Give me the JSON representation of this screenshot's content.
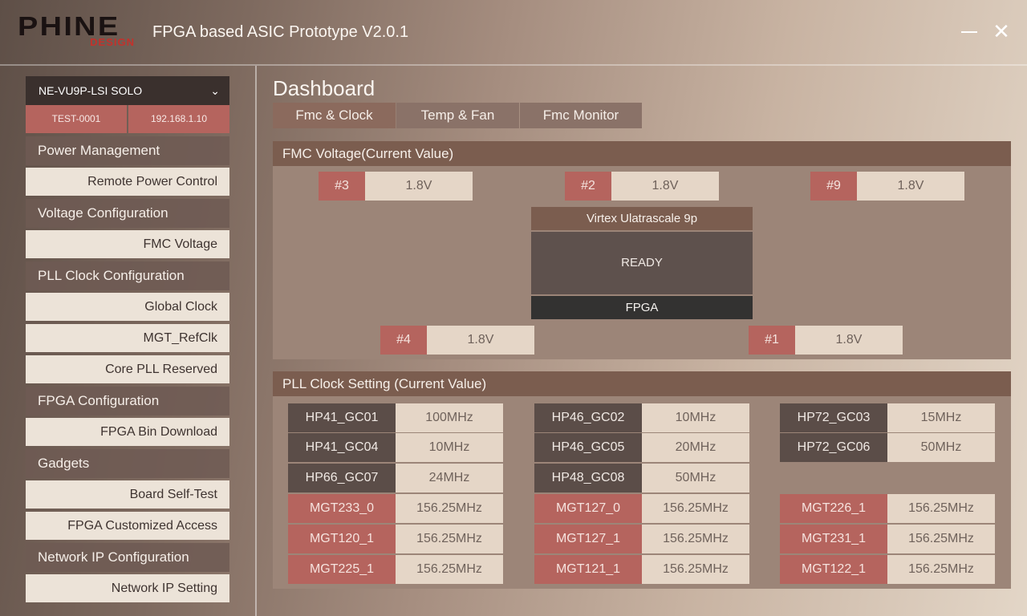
{
  "app": {
    "logo_top": "PHINE",
    "logo_bottom": "DESIGN",
    "title": "FPGA based ASIC Prototype V2.0.1",
    "minimize_label": "",
    "close_label": "✕"
  },
  "device": {
    "name": "NE-VU9P-LSI SOLO",
    "chevron": "⌄",
    "id": "TEST-0001",
    "ip": "192.168.1.10"
  },
  "sidebar": {
    "sections": [
      {
        "header": "Power Management",
        "items": [
          "Remote Power Control"
        ]
      },
      {
        "header": "Voltage Configuration",
        "items": [
          "FMC Voltage"
        ]
      },
      {
        "header": "PLL Clock Configuration",
        "items": [
          "Global Clock",
          "MGT_RefClk",
          "Core PLL Reserved"
        ]
      },
      {
        "header": "FPGA Configuration",
        "items": [
          "FPGA Bin Download"
        ]
      },
      {
        "header": "Gadgets",
        "items": [
          "Board Self-Test",
          "FPGA Customized Access"
        ]
      },
      {
        "header": "Network IP Configuration",
        "items": [
          "Network IP Setting"
        ]
      }
    ]
  },
  "main": {
    "title": "Dashboard",
    "tabs": [
      "Fmc & Clock",
      "Temp & Fan",
      "Fmc Monitor"
    ],
    "active_tab": "Fmc & Clock",
    "fmc_panel": {
      "header": "FMC Voltage(Current Value)",
      "slots": [
        {
          "idx": "#3",
          "value": "1.8V"
        },
        {
          "idx": "#2",
          "value": "1.8V"
        },
        {
          "idx": "#9",
          "value": "1.8V"
        },
        {
          "idx": "#4",
          "value": "1.8V"
        },
        {
          "idx": "#1",
          "value": "1.8V"
        }
      ],
      "fpga": {
        "label": "Virtex Ulatrascale 9p",
        "state": "READY",
        "name": "FPGA"
      }
    },
    "pll_panel": {
      "header": "PLL Clock Setting (Current Value)",
      "clocks": [
        {
          "name": "HP41_GC01",
          "freq": "100MHz",
          "type": "dark"
        },
        {
          "name": "HP46_GC02",
          "freq": "10MHz",
          "type": "dark"
        },
        {
          "name": "HP72_GC03",
          "freq": "15MHz",
          "type": "dark"
        },
        {
          "name": "HP41_GC04",
          "freq": "10MHz",
          "type": "dark"
        },
        {
          "name": "HP46_GC05",
          "freq": "20MHz",
          "type": "dark"
        },
        {
          "name": "HP72_GC06",
          "freq": "50MHz",
          "type": "dark"
        },
        {
          "name": "HP66_GC07",
          "freq": "24MHz",
          "type": "dark"
        },
        {
          "name": "HP48_GC08",
          "freq": "50MHz",
          "type": "dark"
        },
        {
          "name": "MGT233_0",
          "freq": "156.25MHz",
          "type": "red"
        },
        {
          "name": "MGT127_0",
          "freq": "156.25MHz",
          "type": "red"
        },
        {
          "name": "MGT226_1",
          "freq": "156.25MHz",
          "type": "red"
        },
        {
          "name": "MGT120_1",
          "freq": "156.25MHz",
          "type": "red"
        },
        {
          "name": "MGT127_1",
          "freq": "156.25MHz",
          "type": "red"
        },
        {
          "name": "MGT231_1",
          "freq": "156.25MHz",
          "type": "red"
        },
        {
          "name": "MGT225_1",
          "freq": "156.25MHz",
          "type": "red"
        },
        {
          "name": "MGT121_1",
          "freq": "156.25MHz",
          "type": "red"
        },
        {
          "name": "MGT122_1",
          "freq": "156.25MHz",
          "type": "red"
        }
      ]
    }
  }
}
